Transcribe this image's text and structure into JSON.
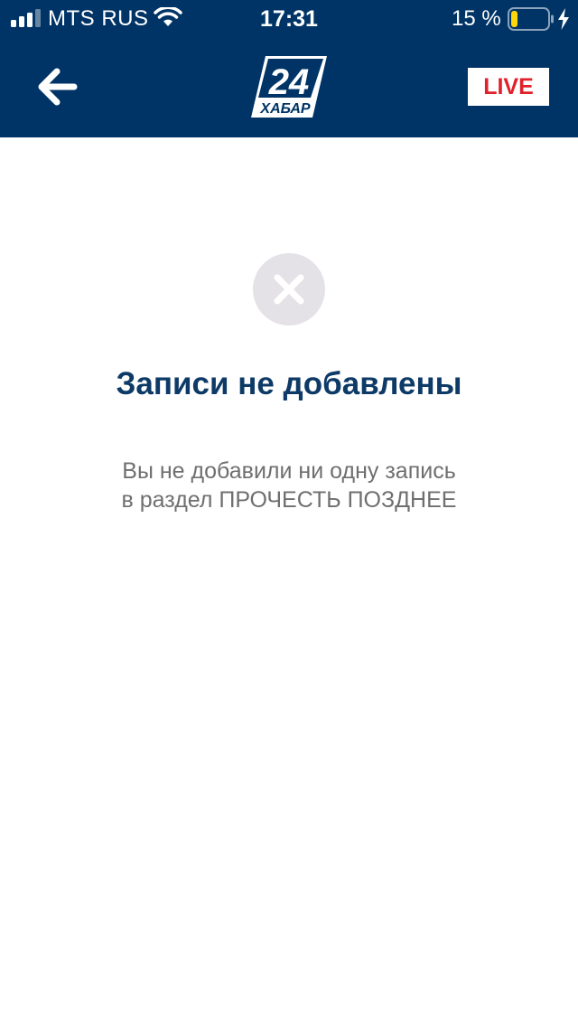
{
  "status_bar": {
    "carrier": "MTS RUS",
    "time": "17:31",
    "battery_percent": "15 %",
    "battery_level": 0.15,
    "signal_bars_filled": 3,
    "signal_bars_total": 4
  },
  "header": {
    "background_color": "#003466",
    "back_icon": "arrow-left-icon",
    "logo": {
      "number": "24",
      "name": "ХАБАР"
    },
    "live_label": "LIVE",
    "live_color": "#e0212b"
  },
  "empty_state": {
    "icon": "close-circle-icon",
    "title": "Записи не добавлены",
    "message": "Вы не добавили ни одну запись в раздел ПРОЧЕСТЬ ПОЗДНЕЕ"
  }
}
